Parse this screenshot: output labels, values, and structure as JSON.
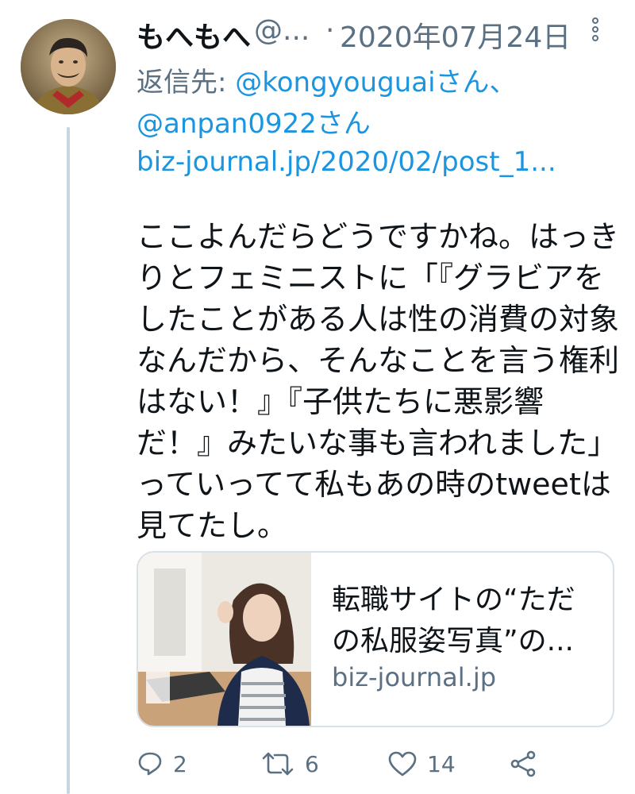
{
  "tweet": {
    "author_name": "もへもへ",
    "author_handle": "@...",
    "separator": "·",
    "date": "2020年07月24日",
    "reply_prefix": "返信先: ",
    "reply_to_1": "@kongyouguaiさん、",
    "reply_to_2": "@anpan0922さん",
    "link": "biz-journal.jp/2020/02/post_1...",
    "text_lines": [
      "ここよんだらどうですかね。はっき",
      "りとフェミニストに「『グラビアを",
      "したことがある人は性の消費の対象",
      "なんだから、そんなことを言う権利",
      "はない！』『子供たちに悪影響",
      "だ！』みたいな事も言われました」",
      "っていってて私もあの時のtweetは",
      "見てたし。"
    ]
  },
  "card": {
    "title_lines": [
      "転職サイトの“ただ",
      "の私服姿写真”の..."
    ],
    "domain": "biz-journal.jp"
  },
  "actions": {
    "replies": "2",
    "retweets": "6",
    "likes": "14"
  },
  "colors": {
    "link": "#1b95e0",
    "secondary": "#5b7083",
    "thread_line": "#c9d6e0"
  }
}
